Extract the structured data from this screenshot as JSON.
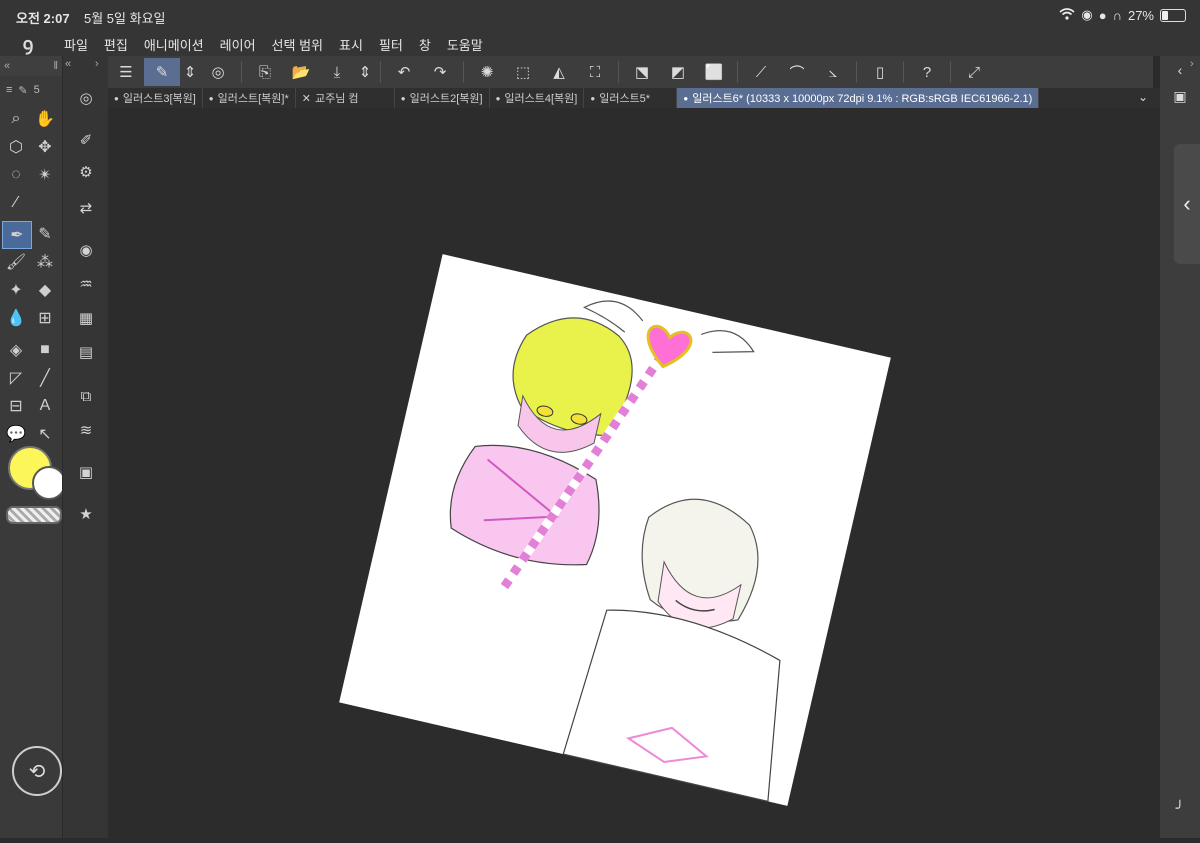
{
  "status_bar": {
    "time": "오전 2:07",
    "date": "5월 5일 화요일",
    "battery": "27%"
  },
  "menu": [
    "파일",
    "편집",
    "애니메이션",
    "레이어",
    "선택 범위",
    "표시",
    "필터",
    "창",
    "도움말"
  ],
  "tabs": [
    {
      "label": "일러스트3[복원]",
      "active": false,
      "marker": "●"
    },
    {
      "label": "일러스트[복원]*",
      "active": false,
      "marker": "●"
    },
    {
      "label": "교주님 컴",
      "active": false,
      "marker": "✕"
    },
    {
      "label": "일러스트2[복원]",
      "active": false,
      "marker": "●"
    },
    {
      "label": "일러스트4[복원]",
      "active": false,
      "marker": "●"
    },
    {
      "label": "일러스트5*",
      "active": false,
      "marker": "●"
    },
    {
      "label": "일러스트6* (10333 x 10000px 72dpi 9.1% : RGB:sRGB IEC61966-2.1)",
      "active": true,
      "marker": "●"
    }
  ],
  "tool_panel": {
    "header_badge": "5",
    "main_color": "#fdf65a",
    "sub_color": "#ffffff"
  }
}
